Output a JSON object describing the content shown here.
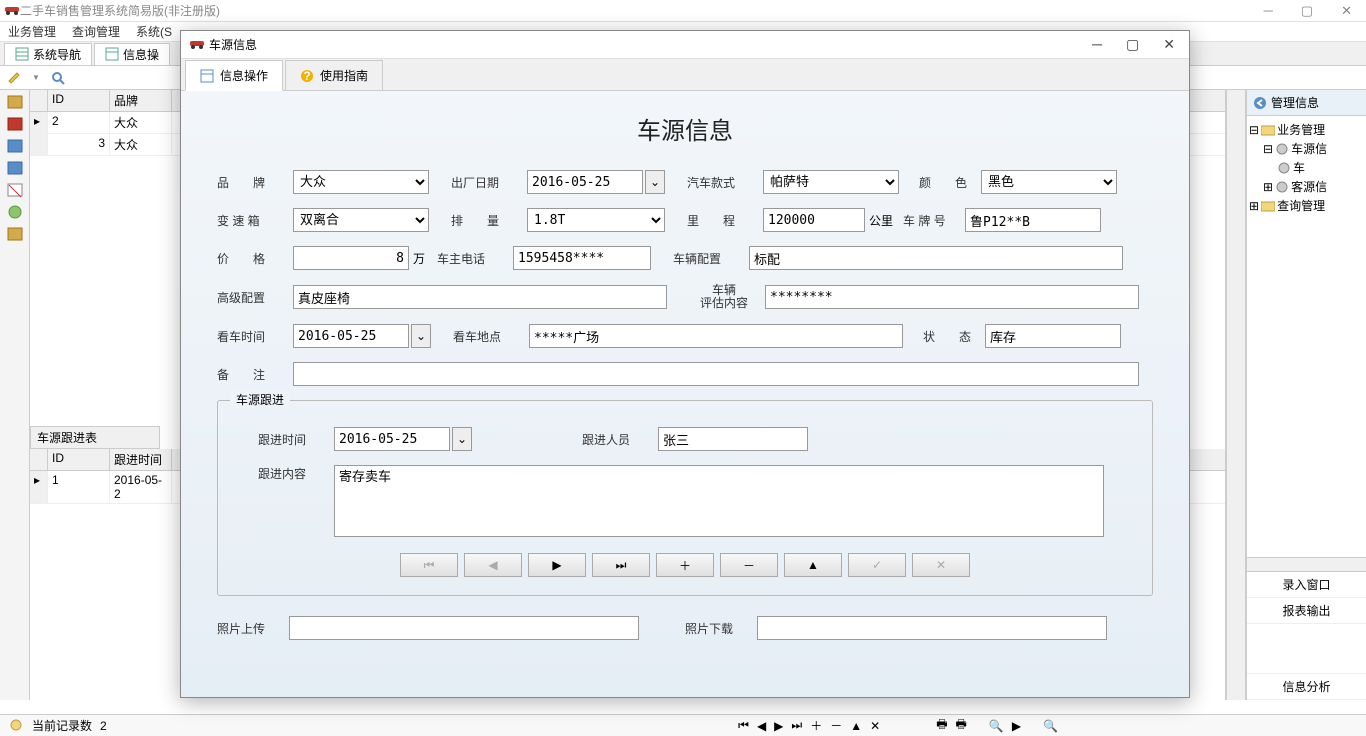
{
  "main_window": {
    "title": "二手车销售管理系统简易版(非注册版)",
    "menu": [
      "业务管理",
      "查询管理",
      "系统(S"
    ],
    "tabs": [
      "系统导航",
      "信息操"
    ],
    "status_prefix": "当前记录数",
    "status_count": "2"
  },
  "grid": {
    "cols": [
      "ID",
      "品牌"
    ],
    "rows": [
      {
        "sel": "▸",
        "id": "2",
        "brand": "大众"
      },
      {
        "sel": "",
        "id": "3",
        "brand": "大众"
      }
    ],
    "sub_title": "车源跟进表",
    "sub_cols": [
      "ID",
      "跟进时间"
    ],
    "sub_rows": [
      {
        "sel": "▸",
        "id": "1",
        "time": "2016-05-2"
      }
    ]
  },
  "right": {
    "header": "管理信息",
    "tree": [
      {
        "lvl": 0,
        "exp": "⊟",
        "icon": "folder",
        "label": "业务管理"
      },
      {
        "lvl": 1,
        "exp": "⊟",
        "icon": "tool",
        "label": "车源信"
      },
      {
        "lvl": 2,
        "exp": "",
        "icon": "tool",
        "label": "车"
      },
      {
        "lvl": 1,
        "exp": "⊞",
        "icon": "tool",
        "label": "客源信"
      },
      {
        "lvl": 0,
        "exp": "⊞",
        "icon": "folder",
        "label": "查询管理"
      }
    ],
    "bottom": [
      "录入窗口",
      "报表输出",
      "信息分析"
    ]
  },
  "modal": {
    "title": "车源信息",
    "tabs": [
      "信息操作",
      "使用指南"
    ],
    "heading": "车源信息",
    "fields": {
      "brand_label": "品　　牌",
      "brand": "大众",
      "mfg_date_label": "出厂日期",
      "mfg_date": "2016-05-25",
      "model_label": "汽车款式",
      "model": "帕萨特",
      "color_label": "颜　　色",
      "color": "黑色",
      "gearbox_label": "变 速 箱",
      "gearbox": "双离合",
      "displacement_label": "排　　量",
      "displacement": "1.8T",
      "mileage_label": "里　　程",
      "mileage": "120000",
      "mileage_unit": "公里",
      "plate_label": "车 牌 号",
      "plate": "鲁P12**B",
      "price_label": "价　　格",
      "price": "8",
      "price_unit": "万",
      "owner_phone_label": "车主电话",
      "owner_phone": "1595458****",
      "config_label": "车辆配置",
      "config": "标配",
      "adv_config_label": "高级配置",
      "adv_config": "真皮座椅",
      "eval_label_1": "车辆",
      "eval_label_2": "评估内容",
      "eval": "********",
      "view_time_label": "看车时间",
      "view_time": "2016-05-25",
      "view_place_label": "看车地点",
      "view_place": "*****广场",
      "status_label": "状　　态",
      "status": "库存",
      "remark_label": "备　　注",
      "remark": ""
    },
    "followup": {
      "title": "车源跟进",
      "time_label": "跟进时间",
      "time": "2016-05-25",
      "person_label": "跟进人员",
      "person": "张三",
      "content_label": "跟进内容",
      "content": "寄存卖车",
      "nav": [
        "⏮",
        "◀",
        "▶",
        "⏭",
        "＋",
        "－",
        "▲",
        "✓",
        "✕"
      ]
    },
    "photo_upload_label": "照片上传",
    "photo_download_label": "照片下载"
  }
}
